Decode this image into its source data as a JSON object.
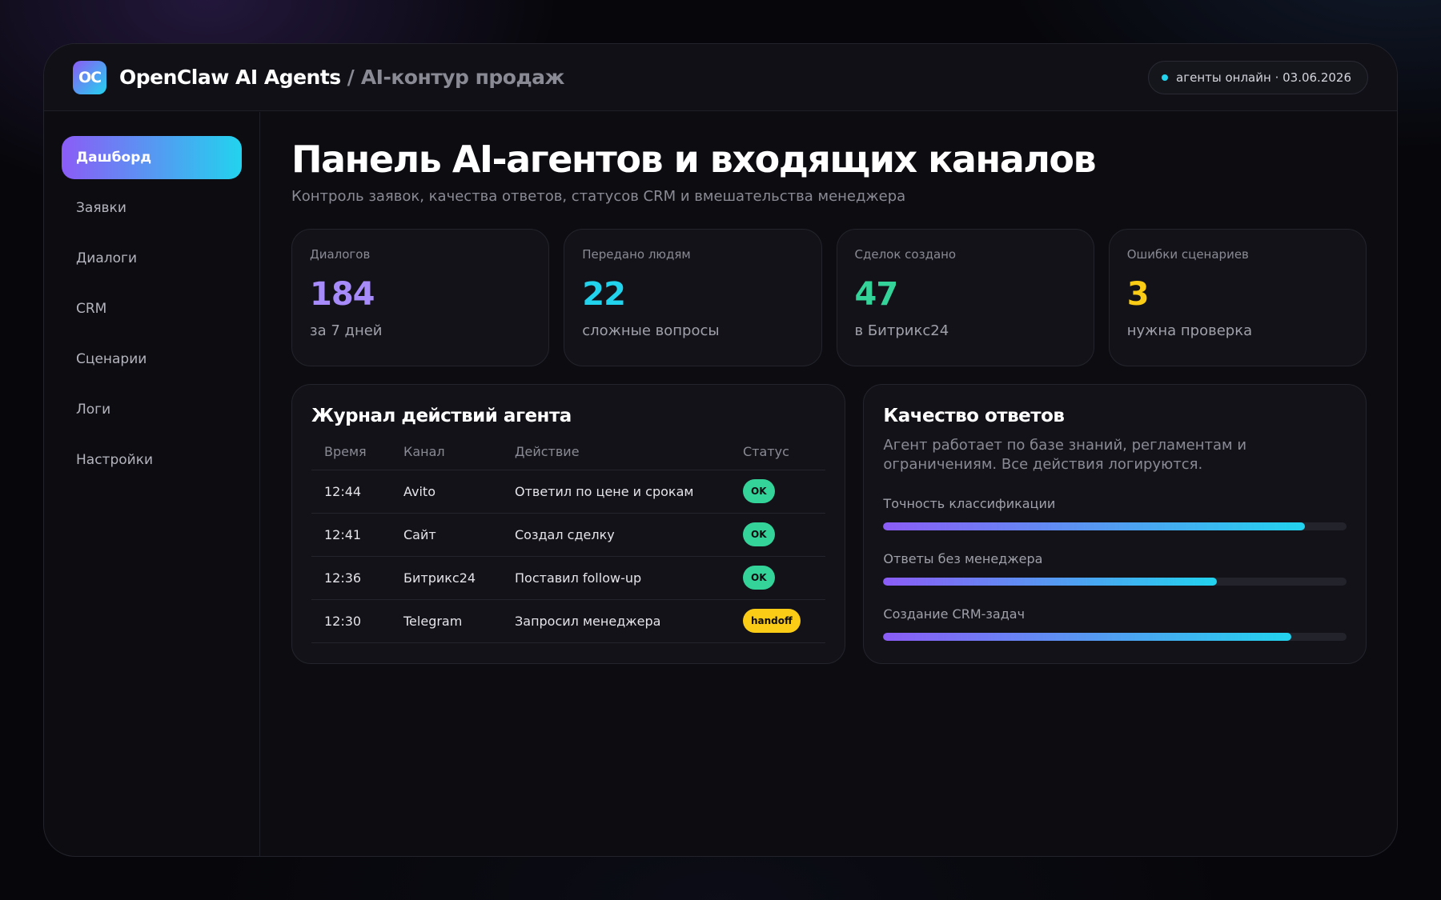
{
  "header": {
    "logo_text": "OC",
    "brand": "OpenClaw AI Agents",
    "separator": "/",
    "section": "AI-контур продаж",
    "status_text": "агенты онлайн · 03.06.2026"
  },
  "sidebar": {
    "items": [
      {
        "label": "Дашборд",
        "active": true
      },
      {
        "label": "Заявки"
      },
      {
        "label": "Диалоги"
      },
      {
        "label": "CRM"
      },
      {
        "label": "Сценарии"
      },
      {
        "label": "Логи"
      },
      {
        "label": "Настройки"
      }
    ]
  },
  "main": {
    "title": "Панель AI-агентов и входящих каналов",
    "subtitle": "Контроль заявок, качества ответов, статусов CRM и вмешательства менеджера"
  },
  "stats": [
    {
      "label": "Диалогов",
      "value": "184",
      "note": "за 7 дней",
      "color": "#a78bfa"
    },
    {
      "label": "Передано людям",
      "value": "22",
      "note": "сложные вопросы",
      "color": "#22d3ee"
    },
    {
      "label": "Сделок создано",
      "value": "47",
      "note": "в Битрикс24",
      "color": "#34d399"
    },
    {
      "label": "Ошибки сценариев",
      "value": "3",
      "note": "нужна проверка",
      "color": "#facc15"
    }
  ],
  "log": {
    "title": "Журнал действий агента",
    "columns": [
      "Время",
      "Канал",
      "Действие",
      "Статус"
    ],
    "rows": [
      {
        "time": "12:44",
        "channel": "Avito",
        "action": "Ответил по цене и срокам",
        "status": "OK",
        "status_type": "ok"
      },
      {
        "time": "12:41",
        "channel": "Сайт",
        "action": "Создал сделку",
        "status": "OK",
        "status_type": "ok"
      },
      {
        "time": "12:36",
        "channel": "Битрикс24",
        "action": "Поставил follow-up",
        "status": "OK",
        "status_type": "ok"
      },
      {
        "time": "12:30",
        "channel": "Telegram",
        "action": "Запросил менеджера",
        "status": "handoff",
        "status_type": "handoff"
      }
    ]
  },
  "quality": {
    "title": "Качество ответов",
    "description": "Агент работает по базе знаний, регламентам и ограничениям. Все действия логируются.",
    "metrics": [
      {
        "label": "Точность классификации",
        "fraction": 0.91
      },
      {
        "label": "Ответы без менеджера",
        "fraction": 0.72
      },
      {
        "label": "Создание CRM-задач",
        "fraction": 0.88
      }
    ]
  },
  "colors": {
    "accent_start": "#8b5cf6",
    "accent_end": "#22d3ee",
    "ok": "#34d399",
    "warning": "#facc15"
  }
}
